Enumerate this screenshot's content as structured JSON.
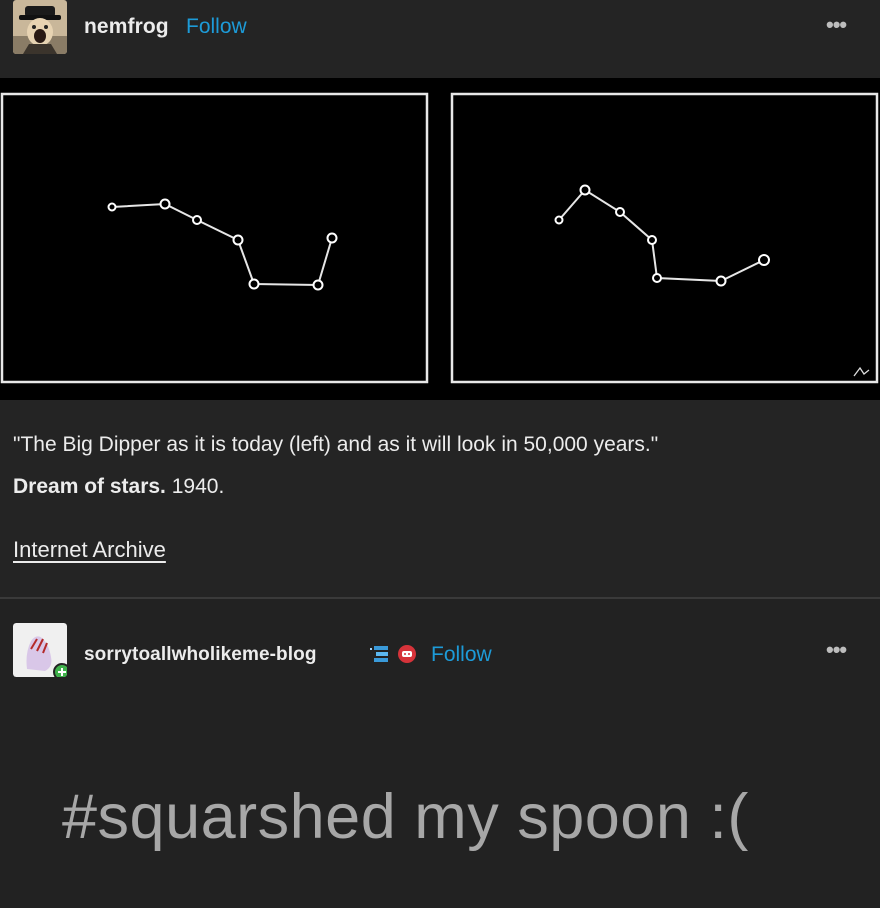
{
  "posts": [
    {
      "username": "nemfrog",
      "follow_label": "Follow",
      "more_label": "•••",
      "caption_quote": "\"The Big Dipper as it is today (left) and as it will look in 50,000 years.\"",
      "source_bold": "Dream of stars.",
      "source_year": " 1940.",
      "link_text": "Internet Archive"
    },
    {
      "username": "sorrytoallwholikeme-blog",
      "follow_label": "Follow",
      "more_label": "•••",
      "tags": "#squarshed my spoon :("
    }
  ],
  "colors": {
    "background": "#222222",
    "follow_accent": "#1d9bd8",
    "text": "#ececec",
    "tag_text": "#a7a7a7"
  },
  "icons": [
    "avatar-nemfrog",
    "avatar-sorrytoallwholikeme",
    "reblog-badge-icon",
    "speech-badge-icon",
    "more-options-icon"
  ]
}
